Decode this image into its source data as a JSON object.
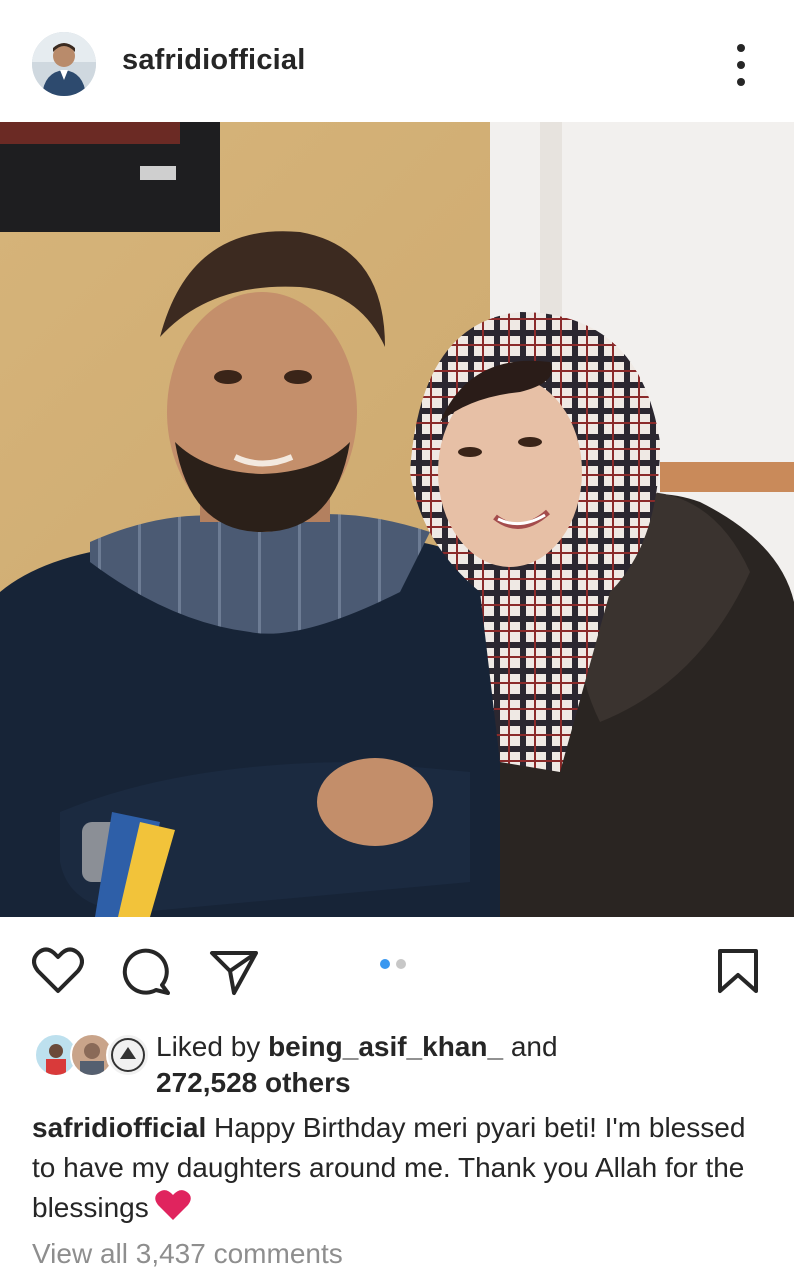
{
  "post": {
    "username": "safridiofficial",
    "photo_label": "Photo of father and daughter in scarves",
    "carousel_index": 1,
    "carousel_count": 2
  },
  "actions": {
    "like_icon": "heart-icon",
    "comment_icon": "comment-icon",
    "share_icon": "send-icon",
    "save_icon": "bookmark-icon"
  },
  "likes": {
    "prefix": "Liked by",
    "top_liker": "being_asif_khan_",
    "and": "and",
    "others": "272,528 others"
  },
  "caption": {
    "username": "safridiofficial",
    "text": "Happy Birthday meri pyari beti! I'm blessed to have my daughters around me. Thank you Allah for the blessings"
  },
  "comments": {
    "view_all": "View all 3,437 comments"
  },
  "colors": {
    "accent_blue": "#3897f0",
    "inactive_dot": "#c7c7c7",
    "text": "#262626",
    "muted": "#8e8e8e",
    "heart_red": "#e0245e"
  }
}
